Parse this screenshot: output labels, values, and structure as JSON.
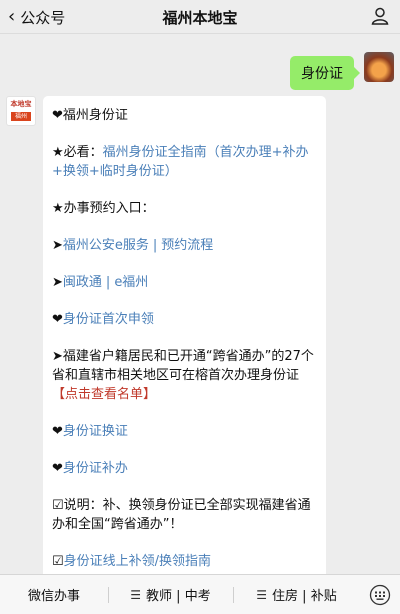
{
  "header": {
    "back_label": "公众号",
    "title": "福州本地宝"
  },
  "outgoing": {
    "text": "身份证"
  },
  "account": {
    "logo_text": "本地宝",
    "logo_tag": "福州"
  },
  "message": {
    "p1": "❤福州身份证",
    "p2_prefix": "★必看：",
    "p2_link": "福州身份证全指南（首次办理+补办+换领+临时身份证）",
    "p3": "★办事预约入口：",
    "p4_arrow": "➤",
    "p4_link1": "福州公安e服务",
    "p4_sep": "|",
    "p4_link2": "预约流程",
    "p5_arrow": "➤",
    "p5_link1": "闽政通",
    "p5_sep": "|",
    "p5_link2": "e福州",
    "p6_heart": "❤",
    "p6_link": "身份证首次申领",
    "p7_text": "➤福建省户籍居民和已开通“跨省通办”的27个省和直辖市相关地区可在榕首次办理身份证",
    "p7_link": "【点击查看名单】",
    "p8_heart": "❤",
    "p8_link": "身份证换证",
    "p9_heart": "❤",
    "p9_link": "身份证补办",
    "p10": "☑说明：补、换领身份证已全部实现福建省通办和全国“跨省通办”！",
    "p11_check": "☑",
    "p11_link": "身份证线上补领/换领指南"
  },
  "bottom_menu": {
    "items": [
      "微信办事",
      "教师 | 中考",
      "住房 | 补贴"
    ]
  },
  "icons": {
    "back": "chevron-left-icon",
    "profile": "person-icon",
    "keyboard": "keyboard-icon",
    "menu": "hamburger-icon"
  },
  "colors": {
    "background": "#ededed",
    "outgoing_bubble": "#95ec69",
    "link": "#4a7fb8",
    "accent": "#d9441d"
  }
}
